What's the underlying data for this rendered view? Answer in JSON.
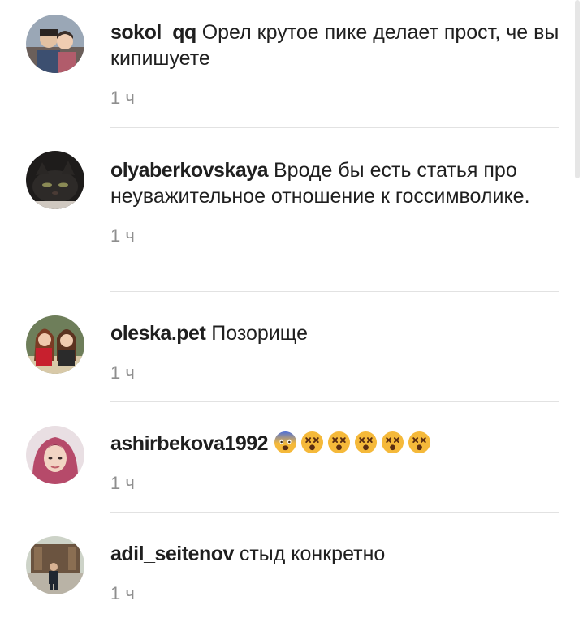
{
  "comments": [
    {
      "username": "sokol_qq",
      "text": "Орел крутое пике делает прост, че вы кипишуете",
      "time": "1 ч"
    },
    {
      "username": "olyaberkovskaya",
      "text": "Вроде бы есть статья про неуважительное отношение к госсимволике.",
      "time": "1 ч"
    },
    {
      "username": "oleska.pet",
      "text": "Позорище",
      "time": "1 ч"
    },
    {
      "username": "ashirbekova1992",
      "text": "",
      "time": "1 ч",
      "emojis": [
        "fearful-face-icon",
        "dizzy-face-icon",
        "dizzy-face-icon",
        "dizzy-face-icon",
        "dizzy-face-icon",
        "dizzy-face-icon"
      ]
    },
    {
      "username": "adil_seitenov",
      "text": "стыд конкретно",
      "time": "1 ч"
    }
  ],
  "colors": {
    "username": "#1f1f1f",
    "text": "#1f1f1f",
    "time": "#8e8e8e",
    "divider": "#e2e2e2",
    "emoji_face": "#f5b93a"
  }
}
